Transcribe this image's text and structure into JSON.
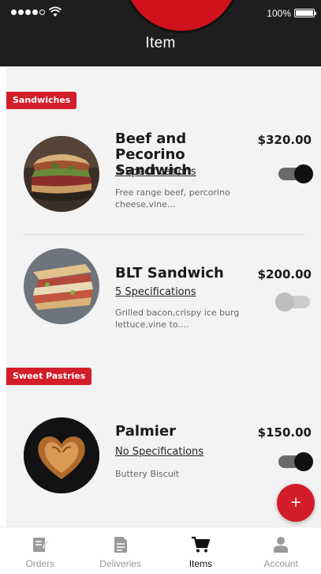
{
  "status_bar": {
    "battery_text": "100%"
  },
  "header": {
    "title": "Item"
  },
  "categories": [
    {
      "label": "Sandwiches",
      "items": [
        {
          "name": "Beef and Pecorino Sandwich",
          "price": "$320.00",
          "specs": "3 Specifications",
          "description": "Free range beef, percorino cheese,vine...",
          "enabled": true
        },
        {
          "name": "BLT Sandwich",
          "price": "$200.00",
          "specs": "5 Specifications",
          "description": "Grilled bacon,crispy ice burg lettuce,vine to....",
          "enabled": false
        }
      ]
    },
    {
      "label": "Sweet Pastries",
      "items": [
        {
          "name": "Palmier",
          "price": "$150.00",
          "specs": "No Specifications",
          "description": "Buttery Biscuit",
          "enabled": true
        }
      ]
    }
  ],
  "fab": {
    "label": "+"
  },
  "bottom_nav": {
    "items": [
      {
        "label": "Orders",
        "icon": "orders-icon",
        "active": false
      },
      {
        "label": "Deliveries",
        "icon": "deliveries-icon",
        "active": false
      },
      {
        "label": "Items",
        "icon": "cart-icon",
        "active": true
      },
      {
        "label": "Account",
        "icon": "account-icon",
        "active": false
      }
    ]
  },
  "colors": {
    "accent": "#d31d2a",
    "header_bg": "#1e1e1e",
    "content_bg": "#f3f3f3",
    "nav_inactive": "#9a9a9a",
    "nav_active": "#111111"
  }
}
